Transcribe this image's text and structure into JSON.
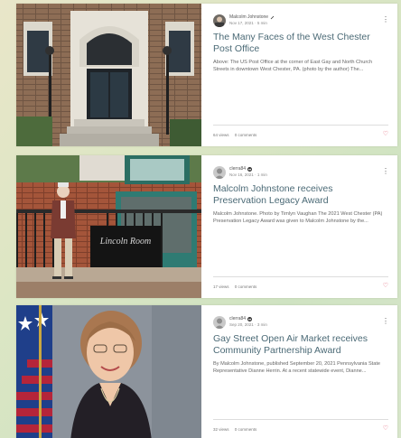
{
  "posts": [
    {
      "author": "Malcolm Johnstone",
      "date": "Nov 17, 2021",
      "read_time": "5 min",
      "title": "The Many Faces of the West Chester Post Office",
      "excerpt": "Above: The US Post Office at the corner of East Gay and North Church Streets in downtown West Chester, PA. (photo by the author) The...",
      "views": "64 views",
      "comments": "0 comments"
    },
    {
      "author": "clerra84",
      "date": "Nov 16, 2021",
      "read_time": "1 min",
      "title": "Malcolm Johnstone receives Preservation Legacy Award",
      "excerpt": "Malcolm Johnstone. Photo by Timlyn Vaughan The 2021 West Chester (PA) Preservation Legacy Award was given to Malcolm Johnstone by the...",
      "views": "17 views",
      "comments": "0 comments",
      "sign_text": "Lincoln Room"
    },
    {
      "author": "clerra84",
      "date": "Sep 20, 2021",
      "read_time": "3 min",
      "title": "Gay Street Open Air Market receives Community Partnership Award",
      "excerpt": "By Malcolm Johnstone, published September 20, 2021 Pennsylvania State Representative Dianne Herrin. At a recent statewide event, Dianne...",
      "views": "32 views",
      "comments": "0 comments"
    }
  ],
  "ui": {
    "more_icon": "⋮",
    "heart_icon": "♡",
    "dot": "·"
  },
  "colors": {
    "title": "#4b6a76",
    "heart": "#e05a6f"
  }
}
